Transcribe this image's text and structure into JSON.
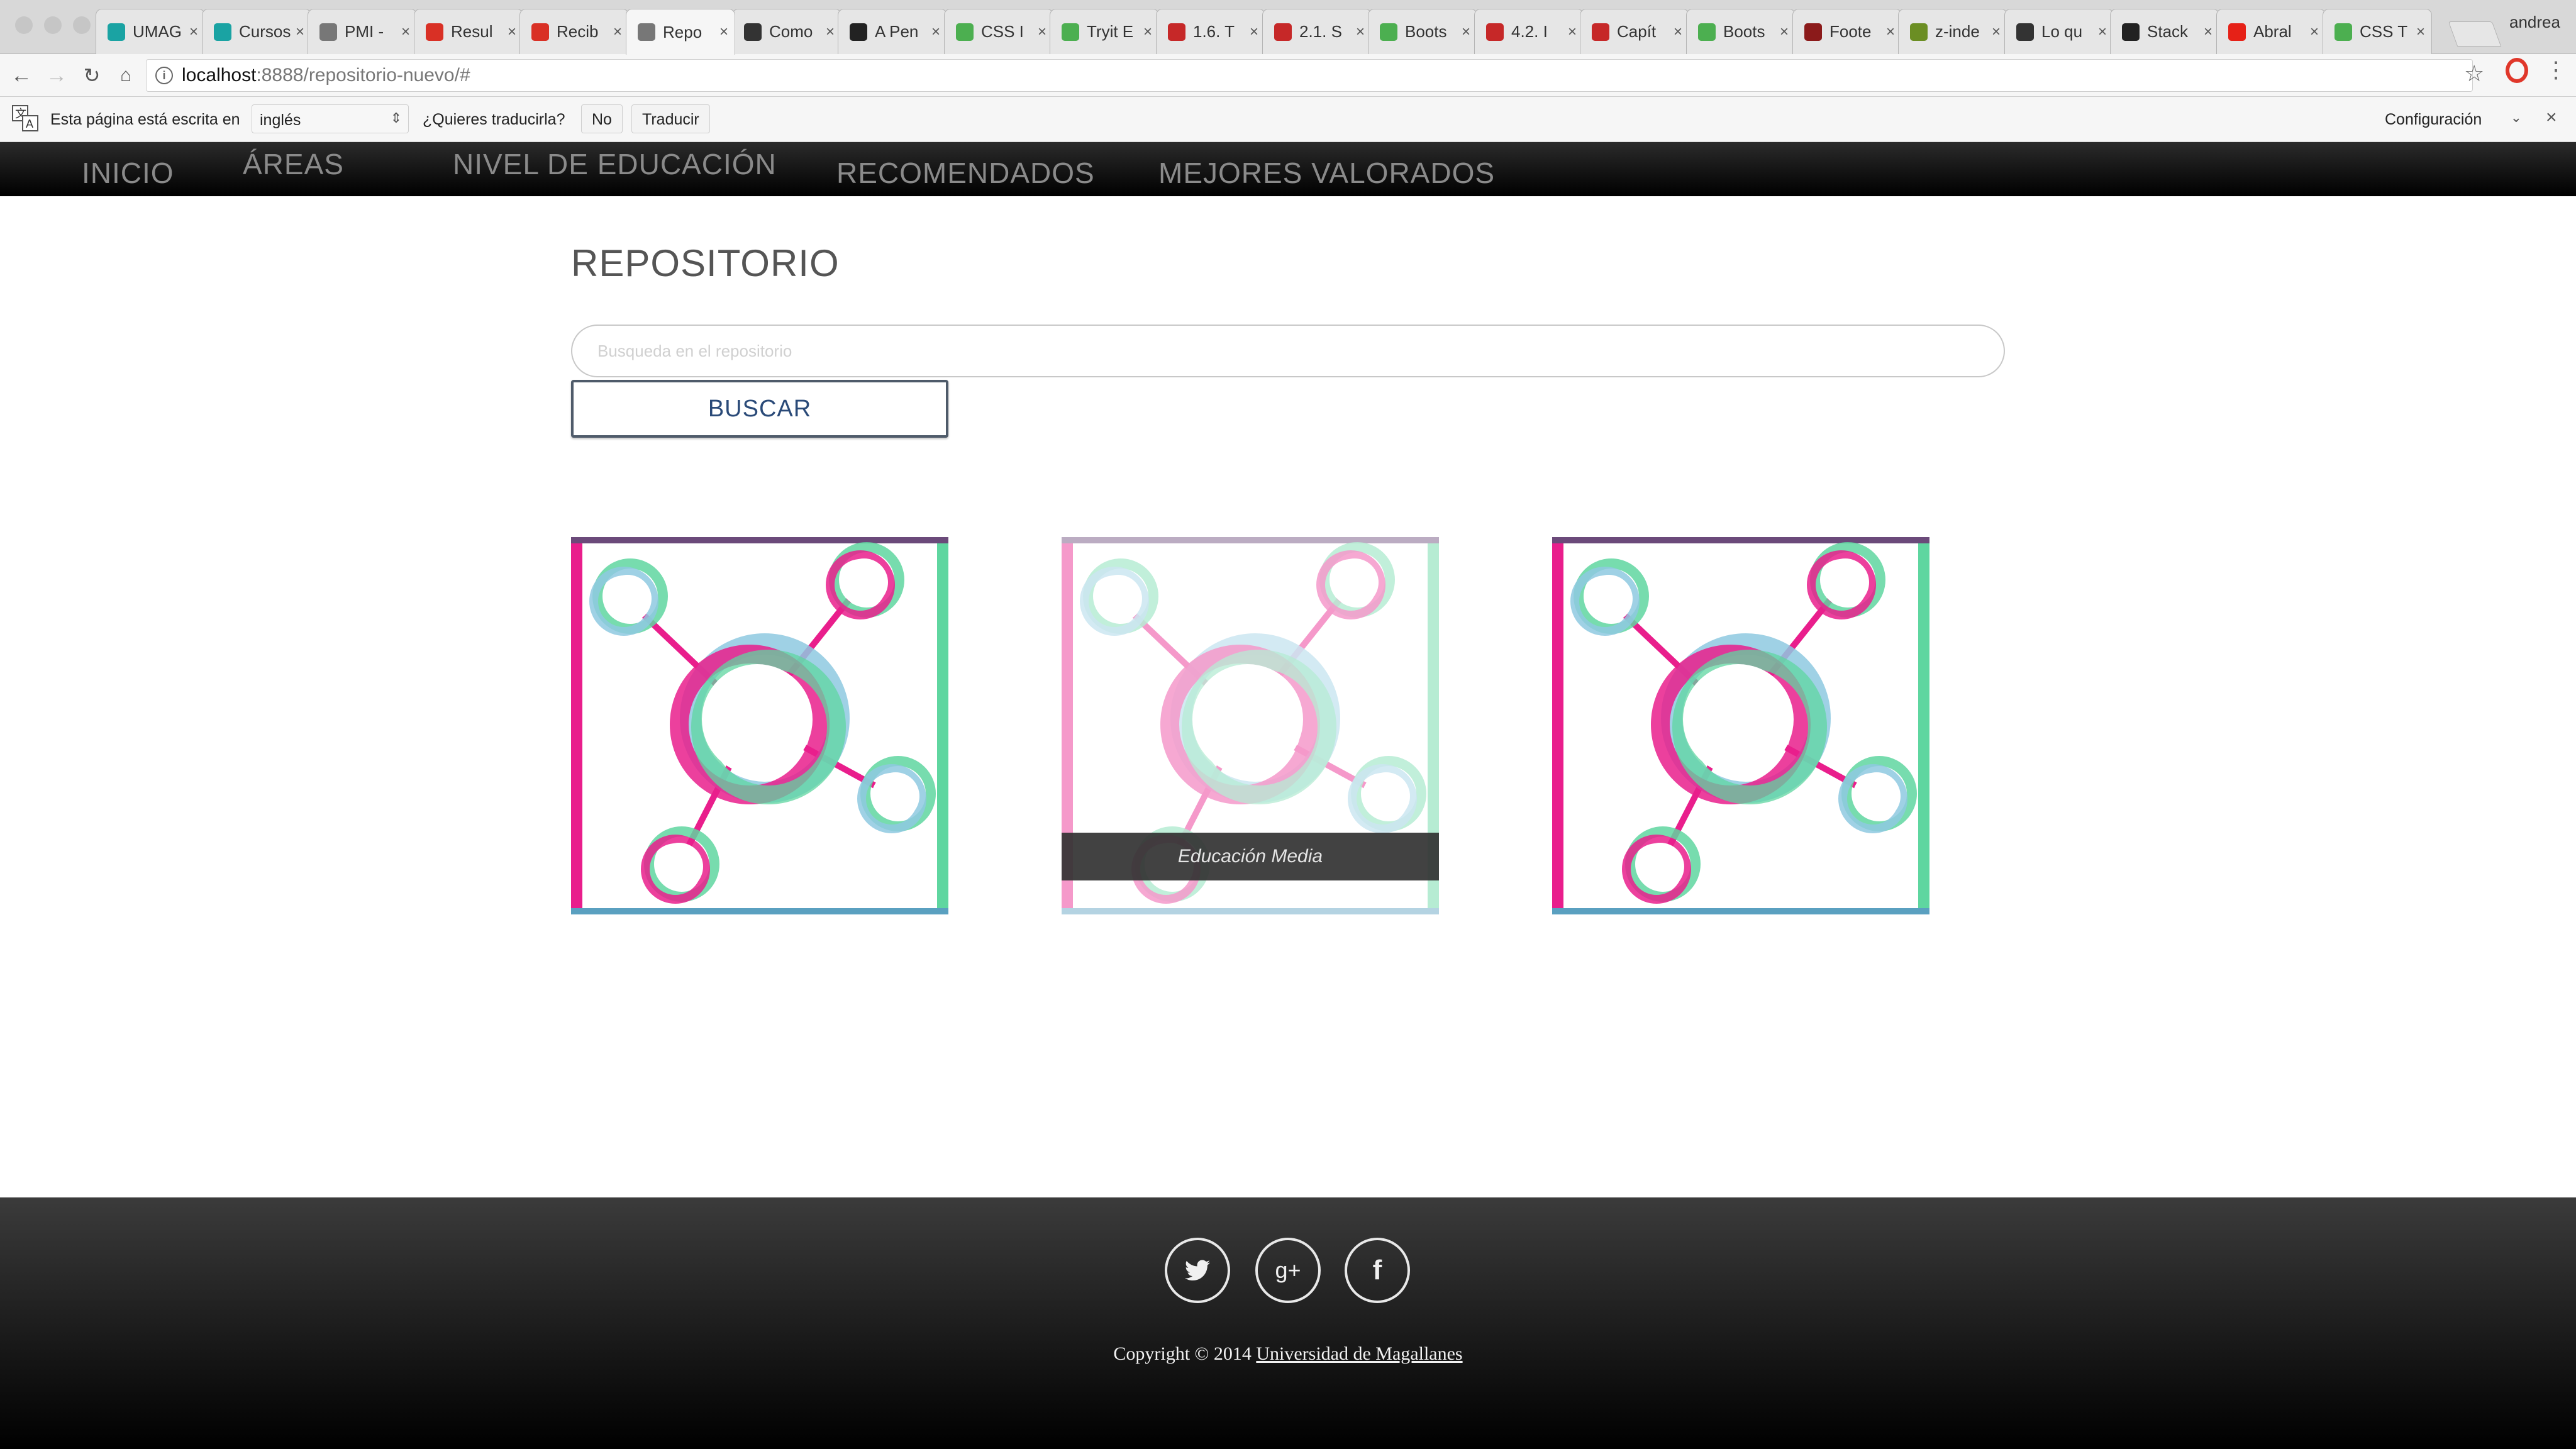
{
  "browser": {
    "tabs": [
      {
        "label": "UMAG",
        "icon": "umag-favicon",
        "color": "#1aa3a3"
      },
      {
        "label": "Cursos",
        "icon": "umag-favicon",
        "color": "#1aa3a3"
      },
      {
        "label": "PMI -",
        "icon": "document-favicon",
        "color": "#777777"
      },
      {
        "label": "Resul",
        "icon": "gmail-favicon",
        "color": "#d93025"
      },
      {
        "label": "Recib",
        "icon": "gmail-favicon",
        "color": "#d93025"
      },
      {
        "label": "Repo",
        "icon": "document-favicon",
        "color": "#777777"
      },
      {
        "label": "Como",
        "icon": "speech-favicon",
        "color": "#333333"
      },
      {
        "label": "A Pen",
        "icon": "codepen-favicon",
        "color": "#222222"
      },
      {
        "label": "CSS I",
        "icon": "w3schools-favicon",
        "color": "#4caf50"
      },
      {
        "label": "Tryit E",
        "icon": "w3schools-favicon",
        "color": "#4caf50"
      },
      {
        "label": "1.6. T",
        "icon": "book-favicon",
        "color": "#c62828"
      },
      {
        "label": "2.1. S",
        "icon": "book-favicon",
        "color": "#c62828"
      },
      {
        "label": "Boots",
        "icon": "w3schools-favicon",
        "color": "#4caf50"
      },
      {
        "label": "4.2. I",
        "icon": "book-favicon",
        "color": "#c62828"
      },
      {
        "label": "Capít",
        "icon": "book-favicon",
        "color": "#c62828"
      },
      {
        "label": "Boots",
        "icon": "w3schools-favicon",
        "color": "#4caf50"
      },
      {
        "label": "Foote",
        "icon": "jp-favicon",
        "color": "#8b1a1a"
      },
      {
        "label": "z-inde",
        "icon": "leaf-favicon",
        "color": "#6b8e23"
      },
      {
        "label": "Lo qu",
        "icon": "square-favicon",
        "color": "#333333"
      },
      {
        "label": "Stack",
        "icon": "codepen-favicon",
        "color": "#222222"
      },
      {
        "label": "Abral",
        "icon": "youtube-favicon",
        "color": "#e62117"
      },
      {
        "label": "CSS T",
        "icon": "w3schools-favicon",
        "color": "#4caf50"
      }
    ],
    "profile": "andrea",
    "url_host": "localhost",
    "url_path": ":8888/repositorio-nuevo/#"
  },
  "translate_bar": {
    "prompt": "Esta página está escrita en",
    "language": "inglés",
    "question": "¿Quieres traducirla?",
    "no_label": "No",
    "translate_label": "Traducir",
    "settings_label": "Configuración"
  },
  "nav": {
    "items": [
      "INICIO",
      "ÁREAS",
      "NIVEL DE EDUCACIÓN",
      "RECOMENDADOS",
      "MEJORES VALORADOS"
    ]
  },
  "main": {
    "title": "REPOSITORIO",
    "search_placeholder": "Busqueda en el repositorio",
    "search_button": "BUSCAR",
    "cards": [
      {
        "caption": ""
      },
      {
        "caption": "Educación Media"
      },
      {
        "caption": ""
      }
    ]
  },
  "footer": {
    "social": [
      {
        "icon": "twitter-icon",
        "glyph": "🐦"
      },
      {
        "icon": "google-plus-icon",
        "glyph": "g+"
      },
      {
        "icon": "facebook-icon",
        "glyph": "f"
      }
    ],
    "copyright_prefix": "Copyright © 2014 ",
    "copyright_link": "Universidad de Magallanes"
  },
  "colors": {
    "nav_text": "#8a8a8a",
    "button_border": "#4f5b6a",
    "button_text": "#2a4a78",
    "card_pink": "#e91e8c",
    "card_green": "#5fd6a0",
    "card_blue": "#8ec9e0"
  }
}
